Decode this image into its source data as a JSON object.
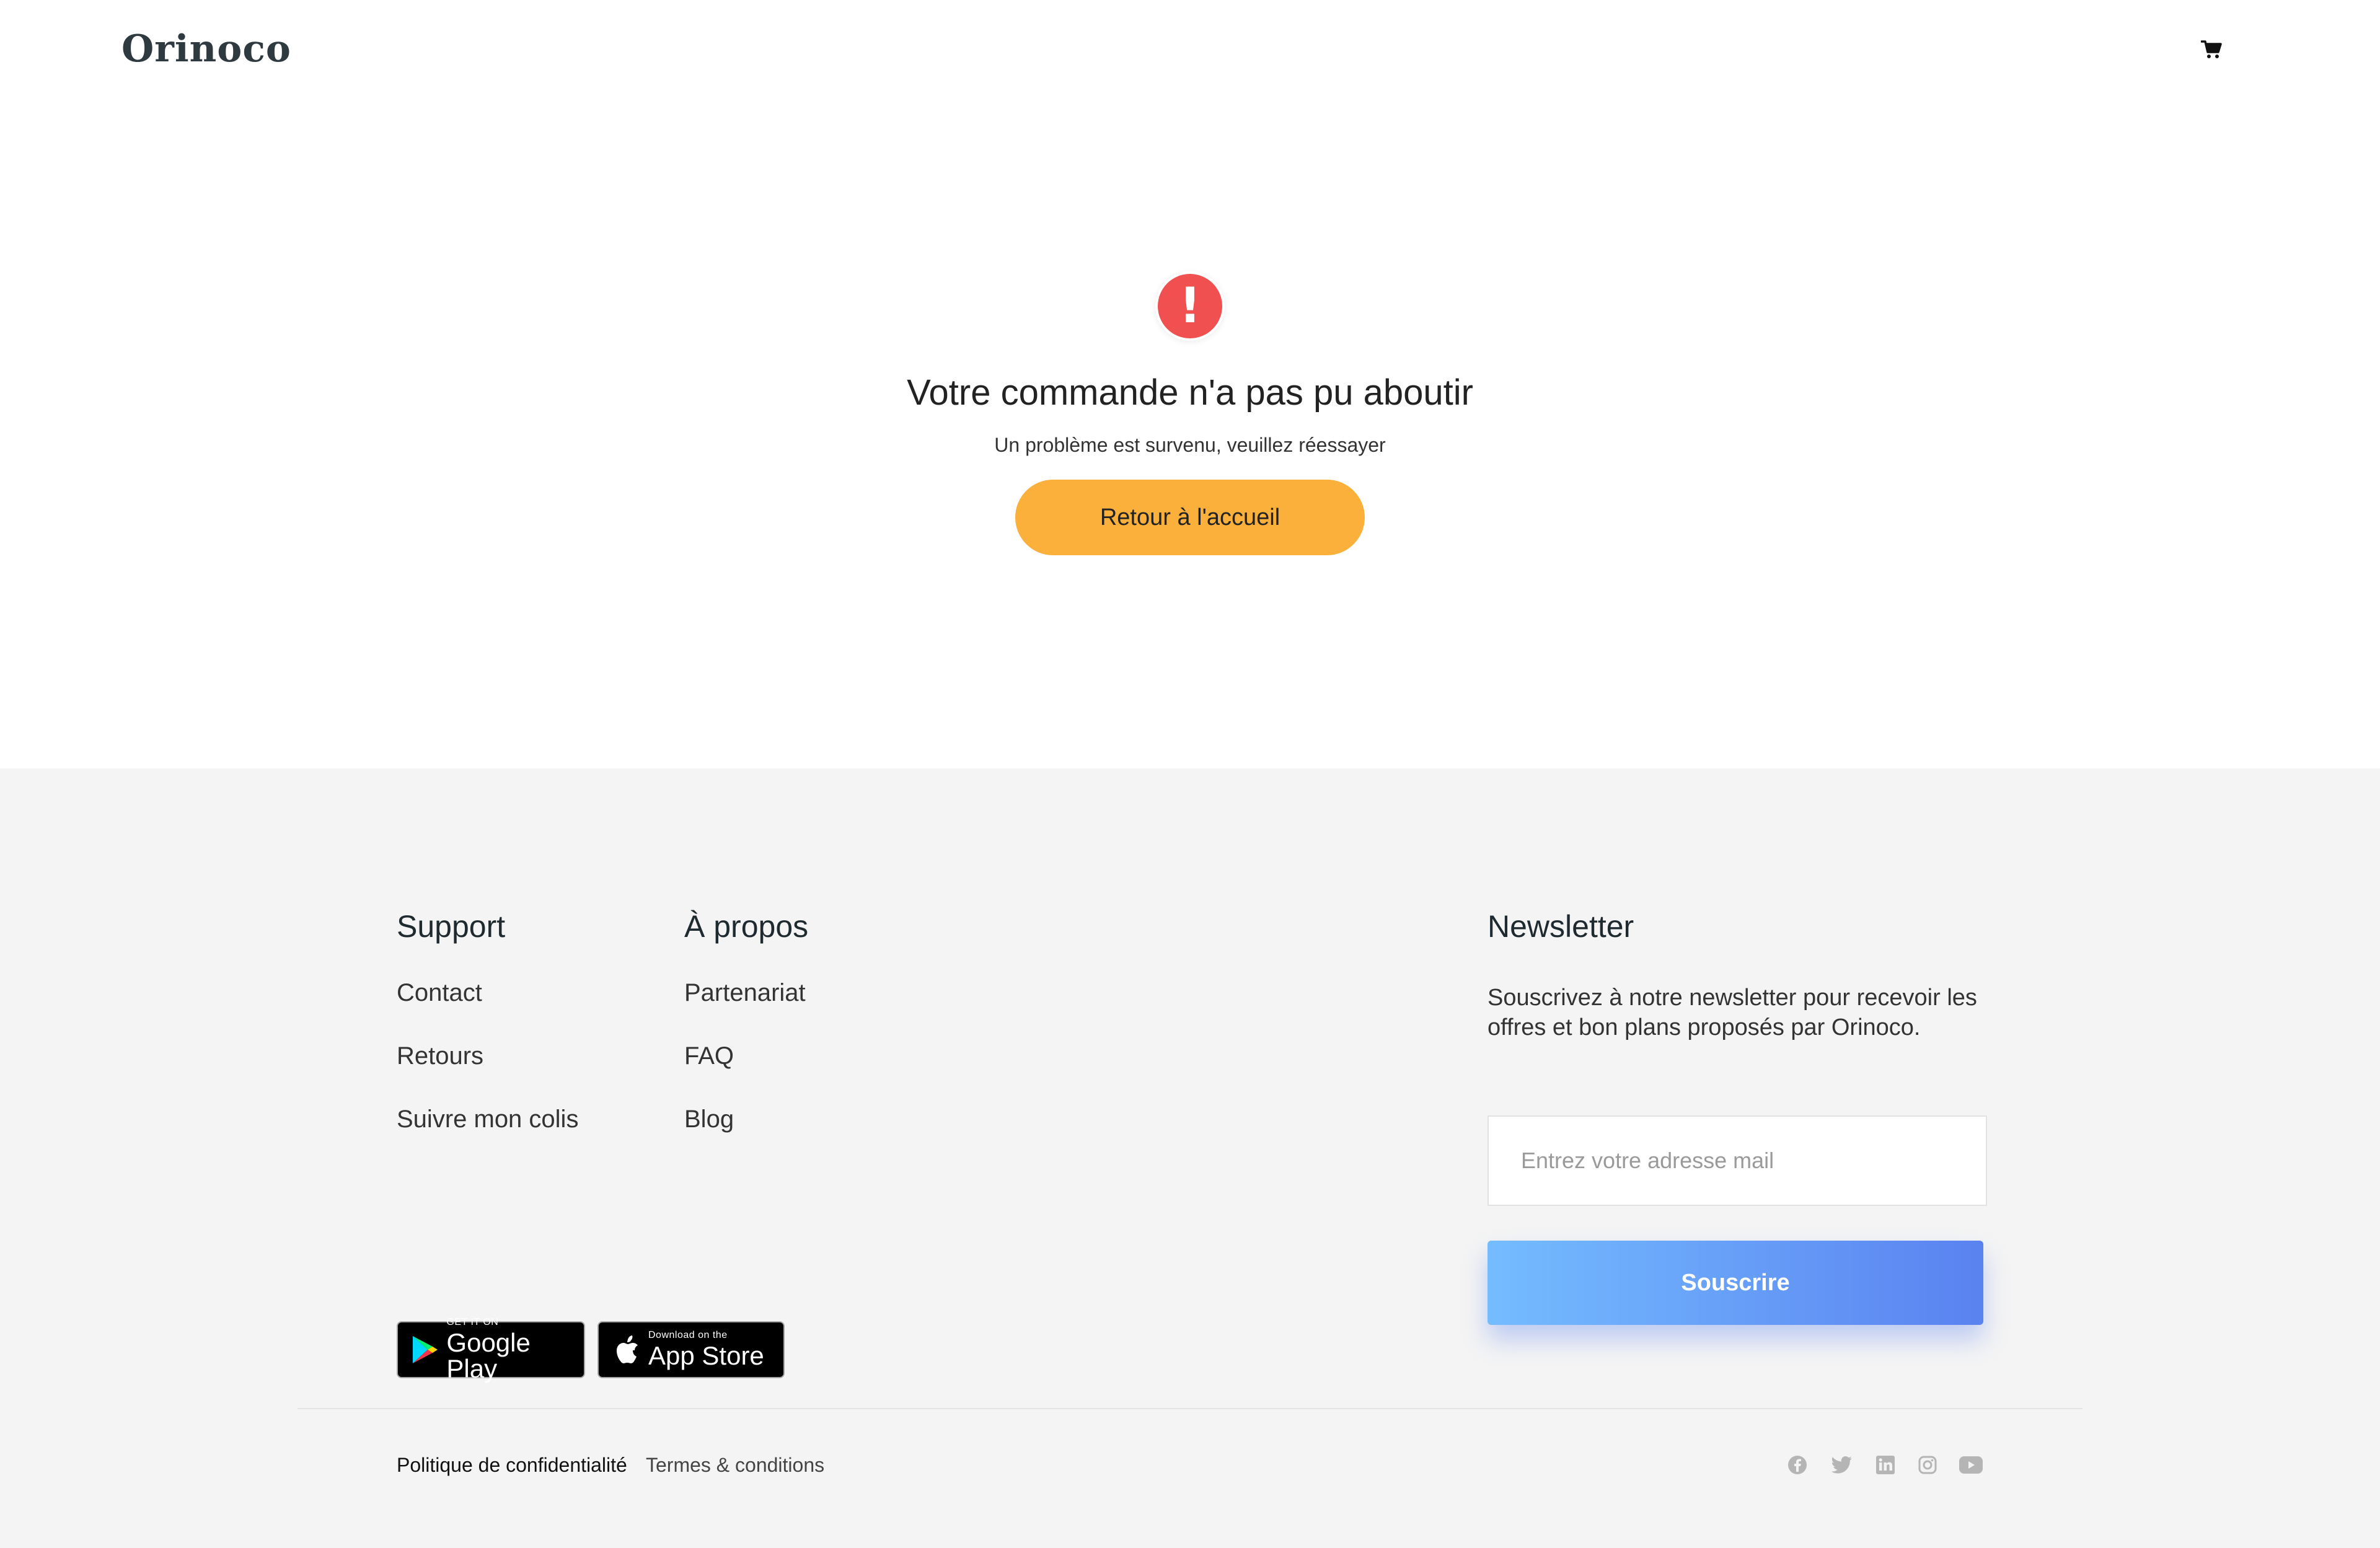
{
  "header": {
    "logo": "Orinoco",
    "cart_icon": "shopping-cart-icon"
  },
  "error": {
    "icon": "exclamation-icon",
    "icon_glyph": "!",
    "title": "Votre commande n'a pas pu aboutir",
    "subtitle": "Un problème est survenu, veuillez réessayer",
    "button_label": "Retour à l'accueil"
  },
  "footer": {
    "support": {
      "title": "Support",
      "links": [
        "Contact",
        "Retours",
        "Suivre mon colis"
      ]
    },
    "about": {
      "title": "À propos",
      "links": [
        "Partenariat",
        "FAQ",
        "Blog"
      ]
    },
    "newsletter": {
      "title": "Newsletter",
      "text": "Souscrivez à notre newsletter pour recevoir les offres et bon plans proposés par Orinoco.",
      "placeholder": "Entrez votre adresse mail",
      "button_label": "Souscrire"
    },
    "badges": {
      "google_small": "GET IT ON",
      "google_big": "Google Play",
      "apple_small": "Download on the",
      "apple_big": "App Store"
    },
    "legal": {
      "privacy": "Politique de confidentialité",
      "terms": "Termes & conditions"
    },
    "social_icons": [
      "facebook-icon",
      "twitter-icon",
      "linkedin-icon",
      "instagram-icon",
      "youtube-icon"
    ]
  },
  "colors": {
    "accent": "#fbb03b",
    "error": "#f0504f",
    "subscribe_gradient_start": "#74bcff",
    "subscribe_gradient_end": "#5a82f0",
    "footer_bg": "#f4f4f4"
  }
}
